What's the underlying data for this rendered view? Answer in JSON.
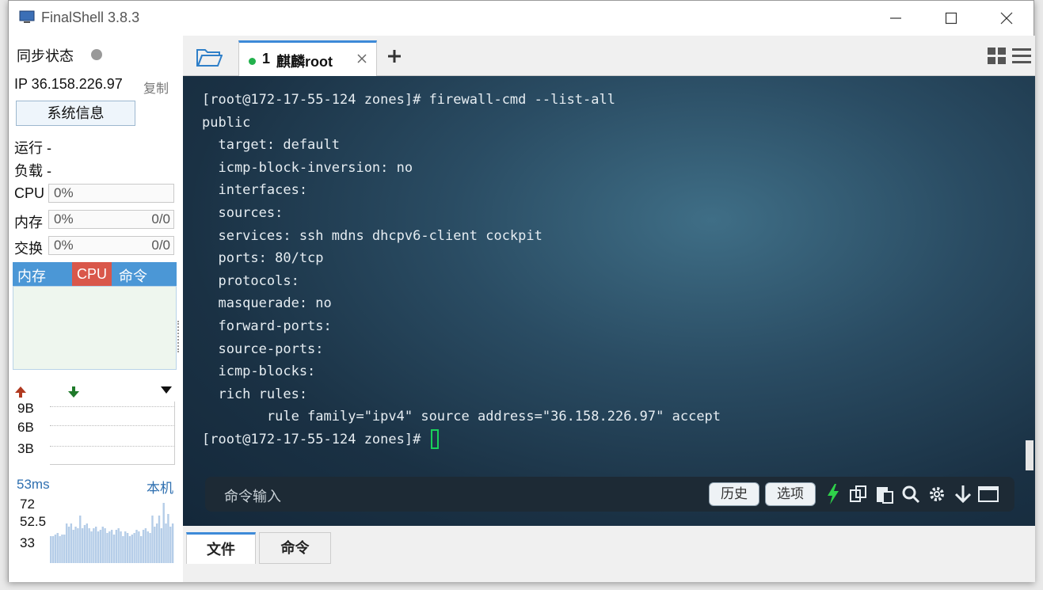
{
  "window": {
    "title": "FinalShell 3.8.3"
  },
  "sidebar": {
    "sync_label": "同步状态",
    "ip_label": "IP 36.158.226.97",
    "copy_label": "复制",
    "sysinfo_button": "系统信息",
    "run_label": "运行 -",
    "load_label": "负载 -",
    "cpu": {
      "label": "CPU",
      "value": "0%"
    },
    "mem": {
      "label": "内存",
      "value": "0%",
      "ratio": "0/0"
    },
    "swap": {
      "label": "交换",
      "value": "0%",
      "ratio": "0/0"
    },
    "proc_tabs": [
      "内存",
      "CPU",
      "命令"
    ],
    "net": {
      "ticks": [
        "9B",
        "6B",
        "3B"
      ]
    },
    "ping": {
      "latency": "53ms",
      "target": "本机",
      "ticks": [
        "72",
        "52.5",
        "33"
      ]
    }
  },
  "tabs": [
    {
      "number": "1",
      "label": "麒麟root",
      "status_color": "#22b14c"
    }
  ],
  "terminal": {
    "lines": [
      "[root@172-17-55-124 zones]# firewall-cmd --list-all",
      "public",
      "  target: default",
      "  icmp-block-inversion: no",
      "  interfaces:",
      "  sources:",
      "  services: ssh mdns dhcpv6-client cockpit",
      "  ports: 80/tcp",
      "  protocols:",
      "  masquerade: no",
      "  forward-ports:",
      "  source-ports:",
      "  icmp-blocks:",
      "  rich rules:",
      "        rule family=\"ipv4\" source address=\"36.158.226.97\" accept"
    ],
    "prompt": "[root@172-17-55-124 zones]# "
  },
  "command_bar": {
    "placeholder": "命令输入",
    "history_label": "历史",
    "options_label": "选项",
    "icons": [
      "lightning-icon",
      "copy-icon",
      "paste-icon",
      "search-icon",
      "gear-icon",
      "download-icon",
      "window-icon"
    ]
  },
  "bottom_tabs": [
    "文件",
    "命令"
  ],
  "colors": {
    "accent": "#3d8ad8",
    "cpu_tab": "#d9574a",
    "terminal_bg": "#1f3a4e"
  }
}
